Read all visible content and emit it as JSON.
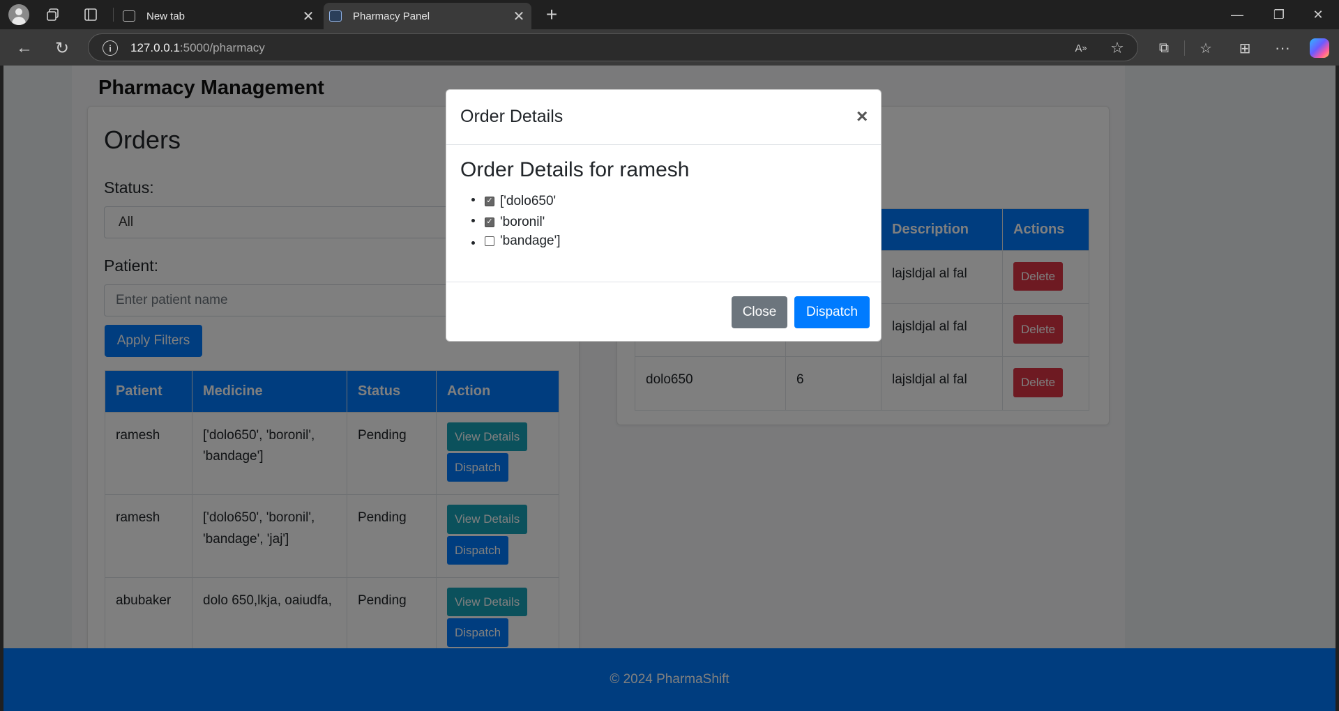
{
  "browser": {
    "tabs": [
      {
        "title": "New tab",
        "active": false
      },
      {
        "title": "Pharmacy Panel",
        "active": true
      }
    ],
    "url": {
      "host": "127.0.0.1",
      "path": ":5000/pharmacy"
    },
    "icons": [
      "profile-icon",
      "workspaces-icon",
      "tab-actions-icon",
      "new-tab-icon",
      "back-icon",
      "reload-icon",
      "site-info-icon",
      "read-aloud-icon",
      "favorite-star-icon",
      "extensions-icon",
      "favorites-icon",
      "collections-icon",
      "more-icon",
      "copilot-icon"
    ]
  },
  "app": {
    "title": "Pharmacy Management"
  },
  "orders": {
    "heading": "Orders",
    "status_label": "Status:",
    "status_value": "All",
    "patient_label": "Patient:",
    "patient_placeholder": "Enter patient name",
    "apply_label": "Apply Filters",
    "columns": [
      "Patient",
      "Medicine",
      "Status",
      "Action"
    ],
    "view_label": "View Details",
    "dispatch_label": "Dispatch",
    "rows": [
      {
        "patient": "ramesh",
        "medicine": "['dolo650', 'boronil', 'bandage']",
        "status": "Pending"
      },
      {
        "patient": "ramesh",
        "medicine": "['dolo650', 'boronil', 'bandage', 'jaj']",
        "status": "Pending"
      },
      {
        "patient": "abubaker",
        "medicine": "dolo 650,lkja, oaiudfa,",
        "status": "Pending"
      }
    ]
  },
  "medicines": {
    "columns": [
      "Description",
      "Actions"
    ],
    "delete_label": "Delete",
    "rows": [
      {
        "name": "",
        "qty": "",
        "description": "lajsldjal al fal"
      },
      {
        "name": "",
        "qty": "",
        "description": "lajsldjal al fal"
      },
      {
        "name": "dolo650",
        "qty": "6",
        "description": "lajsldjal al fal"
      }
    ]
  },
  "footer": {
    "text": "© 2024 PharmaShift"
  },
  "modal": {
    "title": "Order Details",
    "close_symbol": "×",
    "heading": "Order Details for ramesh",
    "items": [
      {
        "label": "['dolo650'",
        "checked": true
      },
      {
        "label": "'boronil'",
        "checked": true
      },
      {
        "label": "'bandage']",
        "checked": false
      }
    ],
    "close_label": "Close",
    "dispatch_label": "Dispatch"
  },
  "colors": {
    "primary": "#007bff",
    "info": "#17a2b8",
    "danger": "#dc3545",
    "secondary": "#6c757d"
  }
}
